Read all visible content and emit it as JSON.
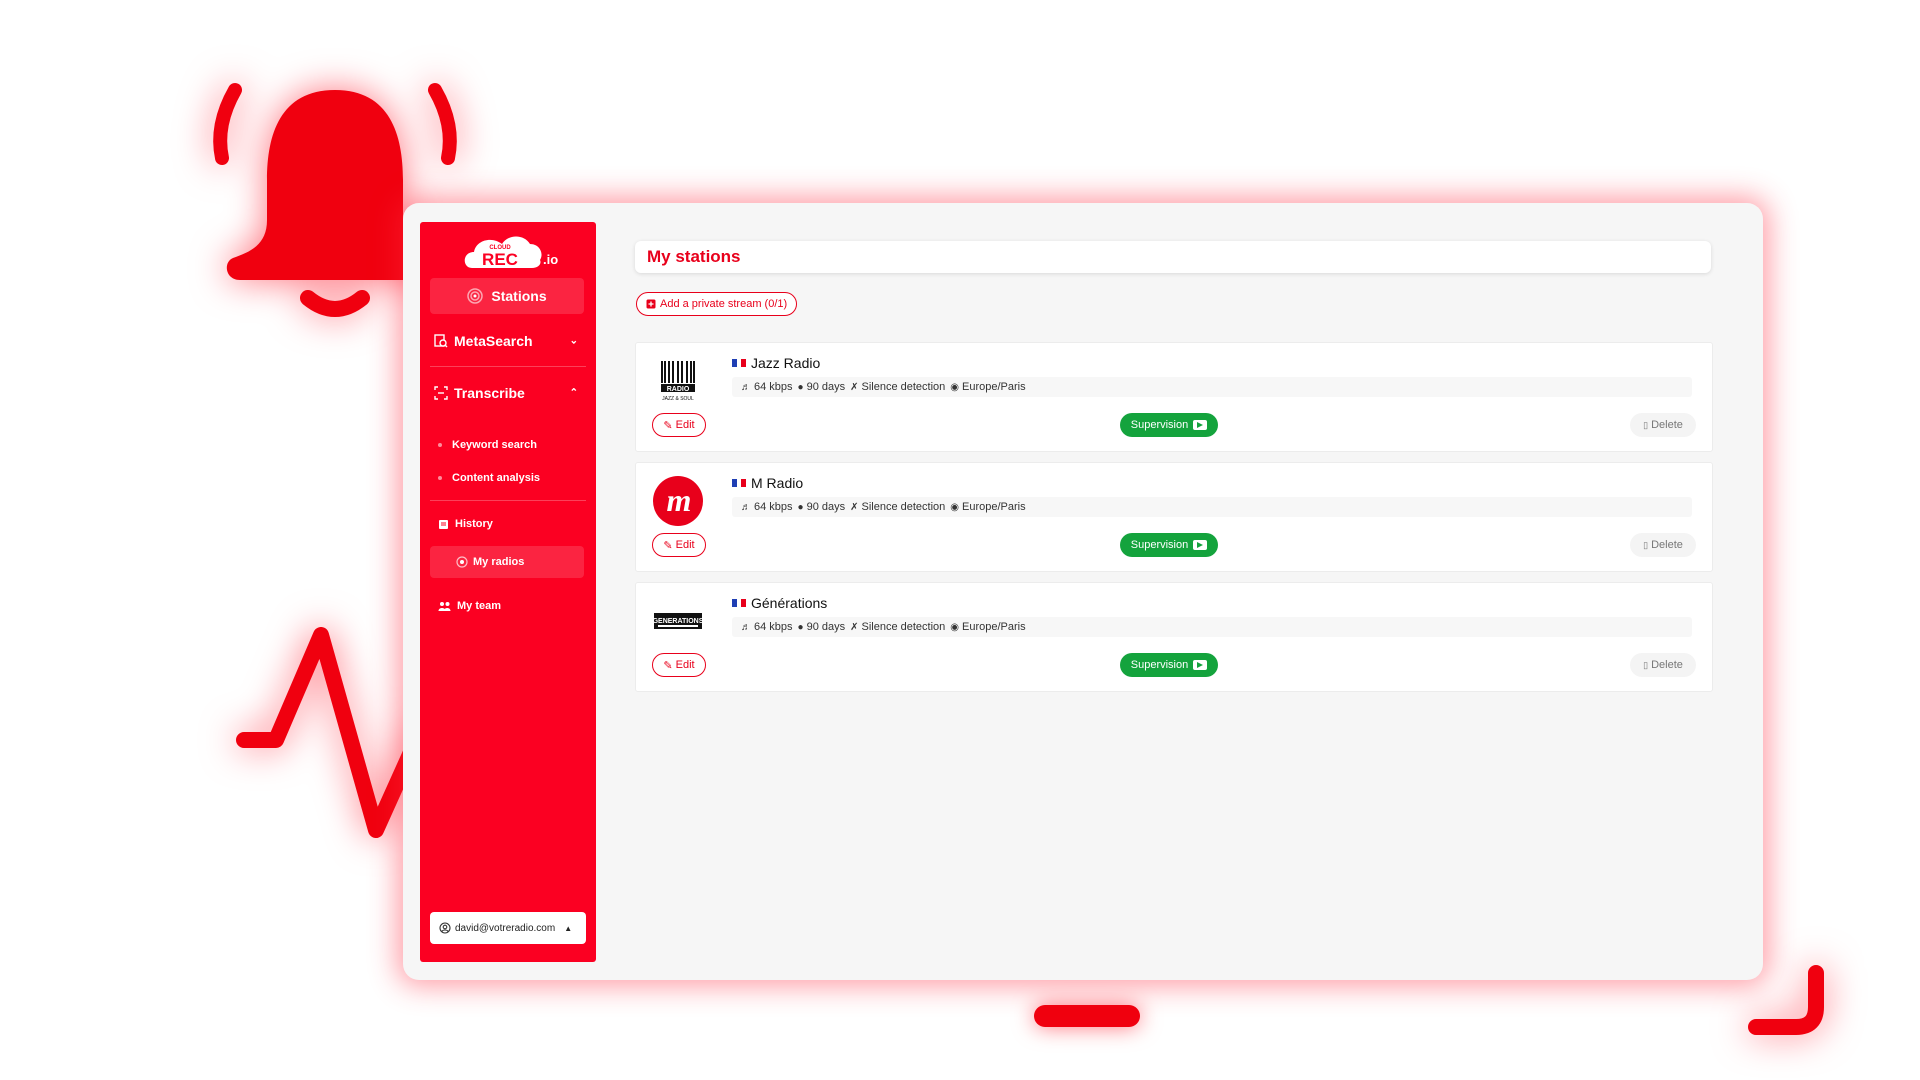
{
  "colors": {
    "brand_red": "#fb0022",
    "accent_red": "#e8001b",
    "supervision_green": "#14a33d"
  },
  "sidebar": {
    "logo_small": "CLOUD",
    "logo_main": "REC",
    "logo_suffix": ".io",
    "stations_label": "Stations",
    "metasearch_label": "MetaSearch",
    "transcribe_label": "Transcribe",
    "keyword_search_label": "Keyword search",
    "content_analysis_label": "Content analysis",
    "history_label": "History",
    "my_radios_label": "My radios",
    "my_team_label": "My team",
    "account_email": "david@votreradio.com"
  },
  "main": {
    "title": "My stations",
    "add_stream_label": "Add a private stream (0/1)",
    "edit_label": "Edit",
    "supervision_label": "Supervision",
    "delete_label": "Delete",
    "stations": [
      {
        "name": "Jazz Radio",
        "bitrate": "64 kbps",
        "retention": "90 days",
        "silence": "Silence detection",
        "timezone": "Europe/Paris",
        "country_flag": "flag-france-icon",
        "logo_text": "JAZZ RADIO",
        "logo_sub": "JAZZ & SOUL"
      },
      {
        "name": "M Radio",
        "bitrate": "64 kbps",
        "retention": "90 days",
        "silence": "Silence detection",
        "timezone": "Europe/Paris",
        "country_flag": "flag-france-icon",
        "logo_text": "m"
      },
      {
        "name": "Générations",
        "bitrate": "64 kbps",
        "retention": "90 days",
        "silence": "Silence detection",
        "timezone": "Europe/Paris",
        "country_flag": "flag-france-icon",
        "logo_text": "GENERATIONS"
      }
    ]
  }
}
